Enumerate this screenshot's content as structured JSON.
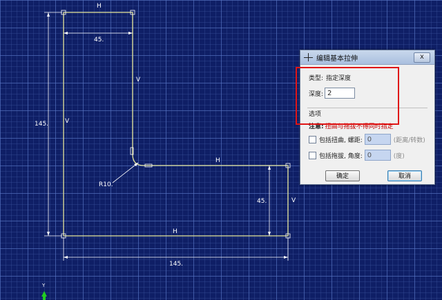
{
  "sketch": {
    "labels": {
      "top_h": "H",
      "dim_45_top": "45.",
      "v_right_upper": "V",
      "v_left": "V",
      "dim_145_left": "145.",
      "radius": "R10.",
      "h_middle": "H",
      "dim_45_right": "45.",
      "v_right_lower": "V",
      "bottom_h": "H",
      "dim_145_bottom": "145.",
      "axis_y": "Y"
    },
    "colors": {
      "profile": "#e8e89a",
      "dimension": "#ffffff",
      "axis_arrow": "#22cc22",
      "background": "#0f1f66"
    }
  },
  "dialog": {
    "title": "编辑基本拉伸",
    "close_label": "x",
    "type_label": "类型:",
    "type_value": "指定深度",
    "depth_label": "深度:",
    "depth_value": "2",
    "options_label": "选项",
    "note_label": "注意:",
    "note_text": "扭曲与拖拔不得同时指定",
    "twist_label": "包括扭曲, 螺距:",
    "twist_value": "0",
    "twist_unit": "(距离/转数)",
    "draft_label": "包括拖拔, 角度:",
    "draft_value": "0",
    "draft_unit": "(度)",
    "ok_label": "确定",
    "cancel_label": "取消",
    "highlight_color": "#e01515"
  }
}
